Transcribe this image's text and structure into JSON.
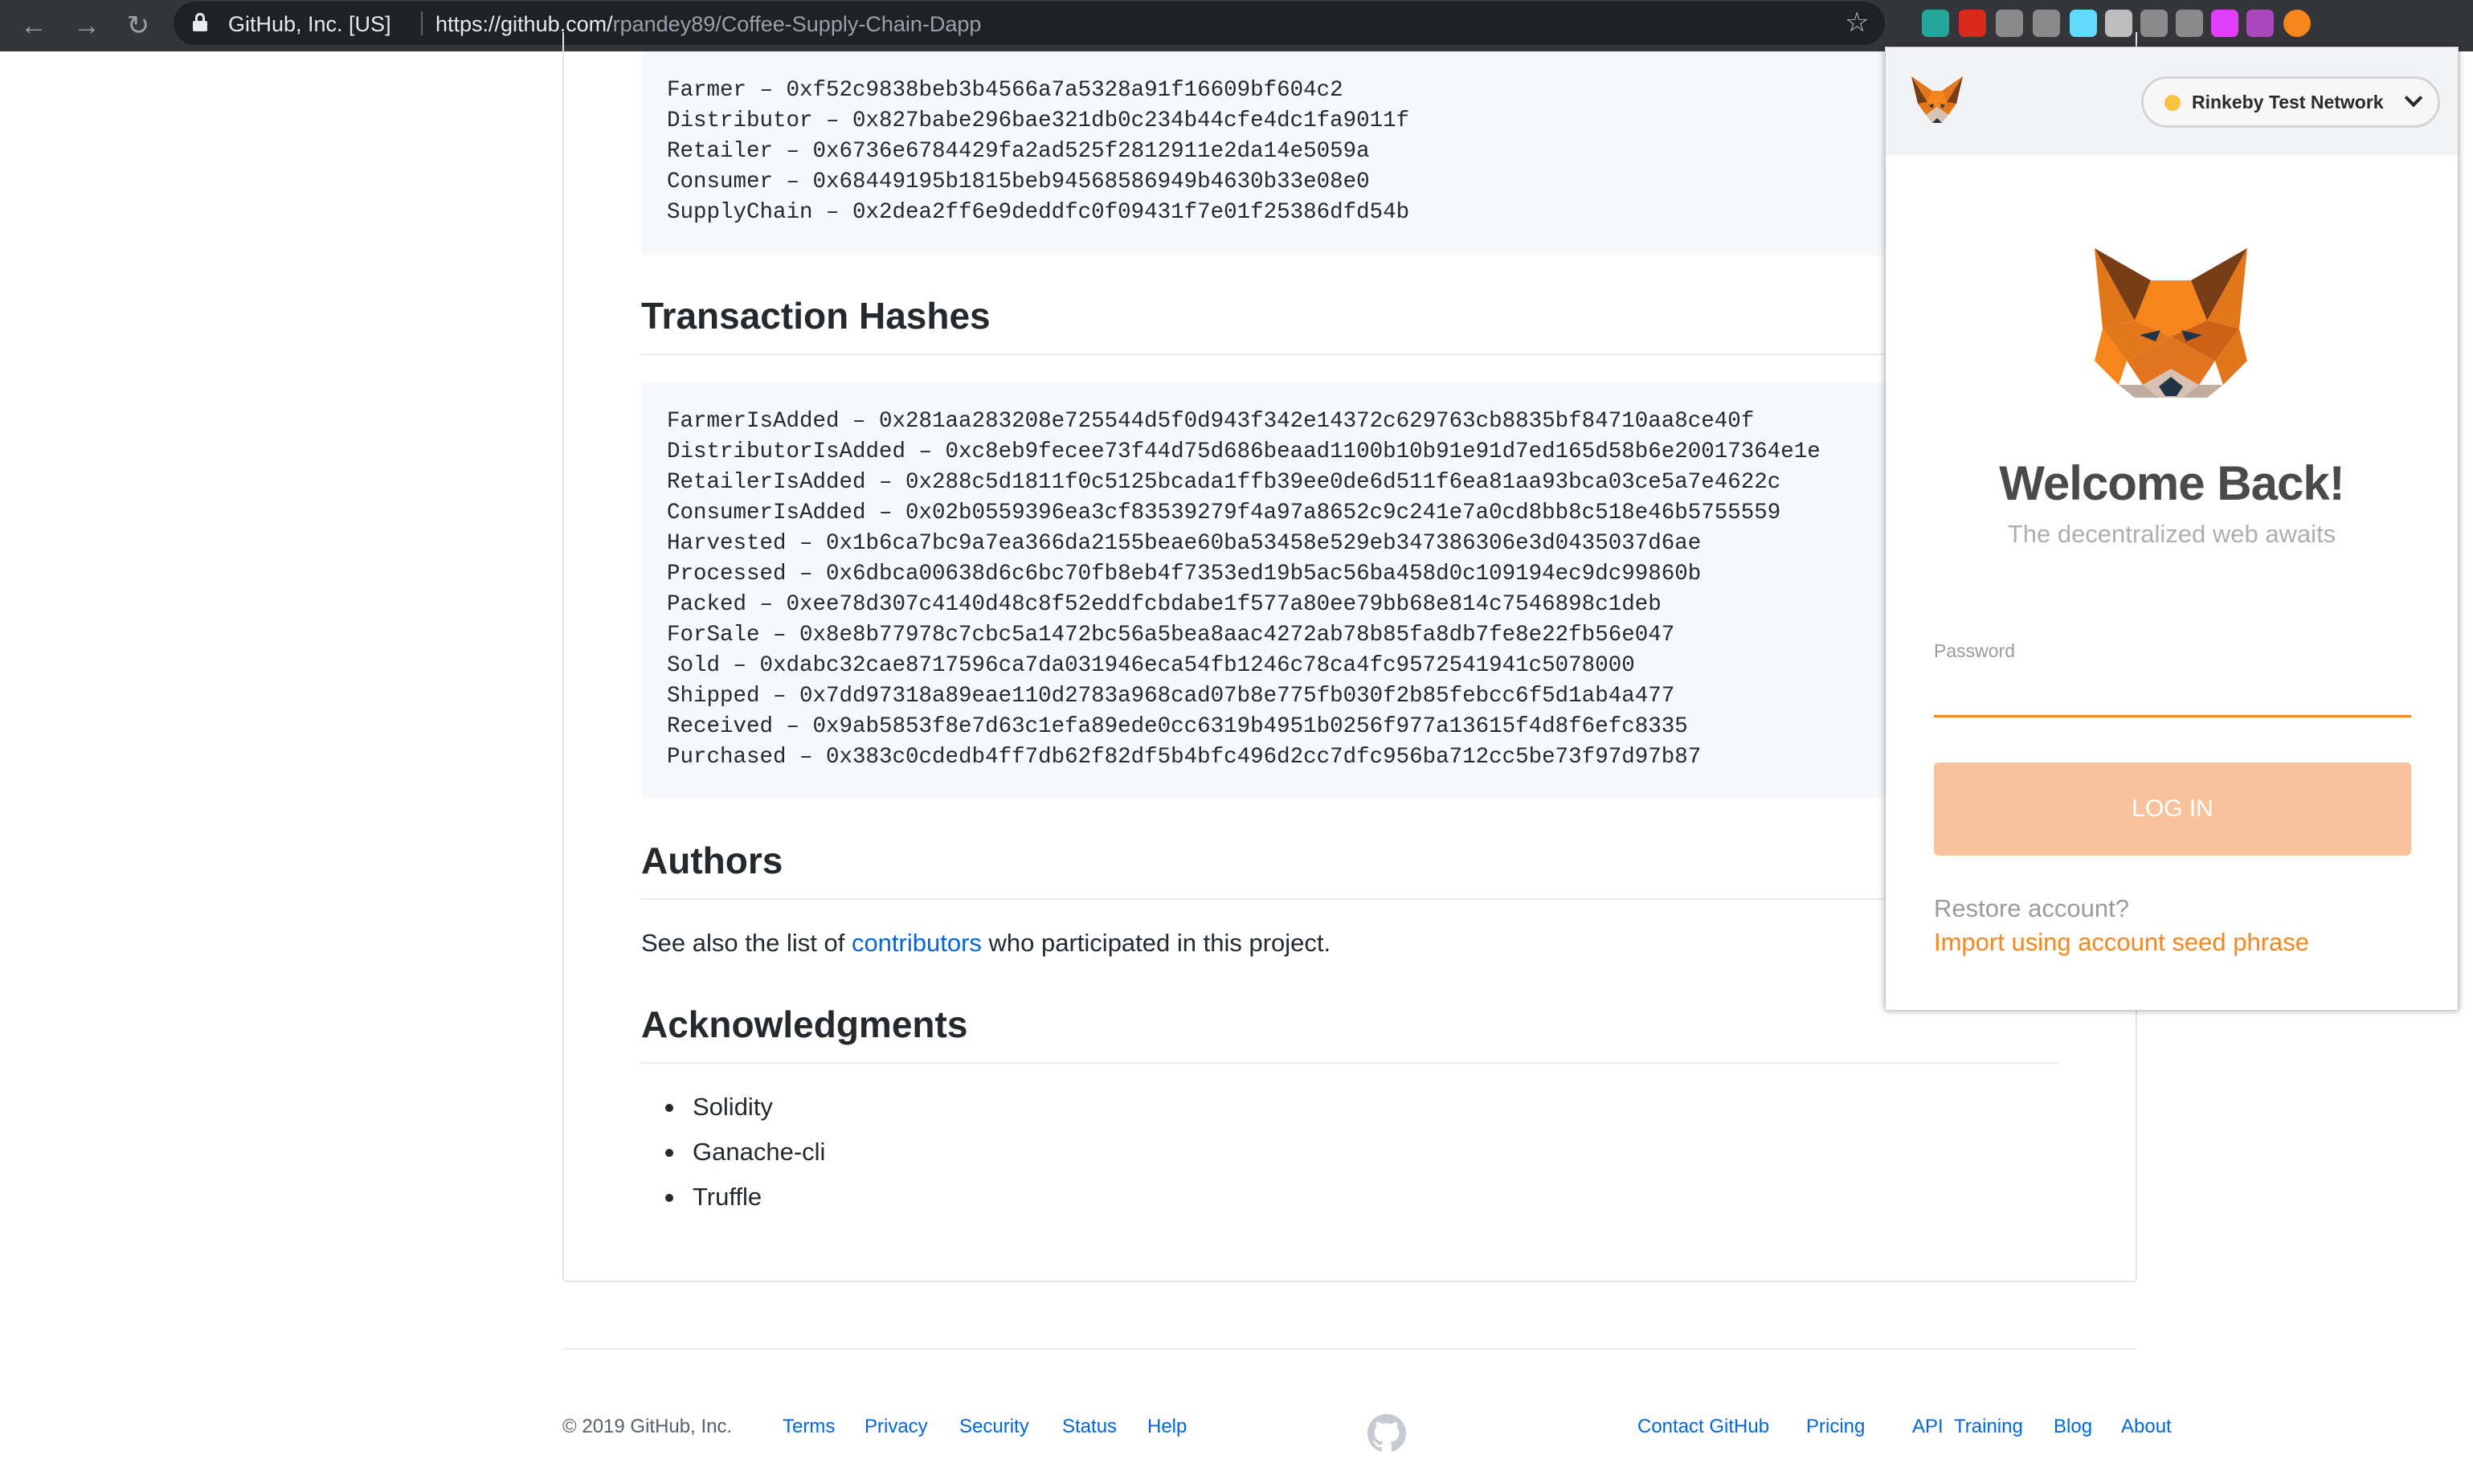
{
  "browser": {
    "site_identity": "GitHub, Inc. [US]",
    "url_host": "https://github.com/",
    "url_path": "rpandey89/Coffee-Supply-Chain-Dapp",
    "back_glyph": "←",
    "forward_glyph": "→",
    "reload_glyph": "↻",
    "star_glyph": "☆",
    "extensions": [
      {
        "name": "extension-m-icon",
        "color": "#26a69a"
      },
      {
        "name": "adblock-icon",
        "color": "#d9291c"
      },
      {
        "name": "grammarly-icon",
        "color": "#8a8a8a"
      },
      {
        "name": "chat-extension-icon",
        "color": "#8a8a8a"
      },
      {
        "name": "react-devtools-icon",
        "color": "#61dafb"
      },
      {
        "name": "target-extension-icon",
        "color": "#bdbdbd"
      },
      {
        "name": "k-extension-icon",
        "color": "#8a8a8a"
      },
      {
        "name": "p-extension-icon",
        "color": "#8a8a8a"
      },
      {
        "name": "colorful-extension-icon",
        "color": "#e040fb"
      },
      {
        "name": "purple-extension-icon",
        "color": "#ab47bc"
      },
      {
        "name": "metamask-extension-icon",
        "color": "#f6851b"
      }
    ]
  },
  "contracts": {
    "lines": [
      "Farmer – 0xf52c9838beb3b4566a7a5328a91f16609bf604c2",
      "Distributor – 0x827babe296bae321db0c234b44cfe4dc1fa9011f",
      "Retailer – 0x6736e6784429fa2ad525f2812911e2da14e5059a",
      "Consumer – 0x68449195b1815beb94568586949b4630b33e08e0",
      "SupplyChain – 0x2dea2ff6e9deddfc0f09431f7e01f25386dfd54b"
    ]
  },
  "transaction_hashes": {
    "heading": "Transaction Hashes",
    "lines": [
      "FarmerIsAdded – 0x281aa283208e725544d5f0d943f342e14372c629763cb8835bf84710aa8ce40f",
      "DistributorIsAdded – 0xc8eb9fecee73f44d75d686beaad1100b10b91e91d7ed165d58b6e20017364e1e",
      "RetailerIsAdded – 0x288c5d1811f0c5125bcada1ffb39ee0de6d511f6ea81aa93bca03ce5a7e4622c",
      "ConsumerIsAdded – 0x02b0559396ea3cf83539279f4a97a8652c9c241e7a0cd8bb8c518e46b5755559",
      "Harvested – 0x1b6ca7bc9a7ea366da2155beae60ba53458e529eb347386306e3d0435037d6ae",
      "Processed – 0x6dbca00638d6c6bc70fb8eb4f7353ed19b5ac56ba458d0c109194ec9dc99860b",
      "Packed – 0xee78d307c4140d48c8f52eddfcbdabe1f577a80ee79bb68e814c7546898c1deb",
      "ForSale – 0x8e8b77978c7cbc5a1472bc56a5bea8aac4272ab78b85fa8db7fe8e22fb56e047",
      "Sold – 0xdabc32cae8717596ca7da031946eca54fb1246c78ca4fc9572541941c5078000",
      "Shipped – 0x7dd97318a89eae110d2783a968cad07b8e775fb030f2b85febcc6f5d1ab4a477",
      "Received – 0x9ab5853f8e7d63c1efa89ede0cc6319b4951b0256f977a13615f4d8f6efc8335",
      "Purchased – 0x383c0cdedb4ff7db62f82df5b4bfc496d2cc7dfc956ba712cc5be73f97d97b87"
    ]
  },
  "authors": {
    "heading": "Authors",
    "text_before": "See also the list of ",
    "link": "contributors",
    "text_after": " who participated in this project."
  },
  "acknowledgments": {
    "heading": "Acknowledgments",
    "items": [
      "Solidity",
      "Ganache-cli",
      "Truffle"
    ]
  },
  "footer": {
    "copyright": "© 2019 GitHub, Inc.",
    "left_links": [
      "Terms",
      "Privacy",
      "Security",
      "Status",
      "Help"
    ],
    "right_links": [
      "Contact GitHub",
      "Pricing",
      "API",
      "Training",
      "Blog",
      "About"
    ]
  },
  "metamask": {
    "network": "Rinkeby Test Network",
    "network_status_color": "#f6c343",
    "welcome": "Welcome Back!",
    "tagline": "The decentralized web awaits",
    "password_label": "Password",
    "password_value": "",
    "login_button": "LOG IN",
    "restore_prompt": "Restore account?",
    "import_link": "Import using account seed phrase",
    "accent_color": "#f7861c"
  }
}
